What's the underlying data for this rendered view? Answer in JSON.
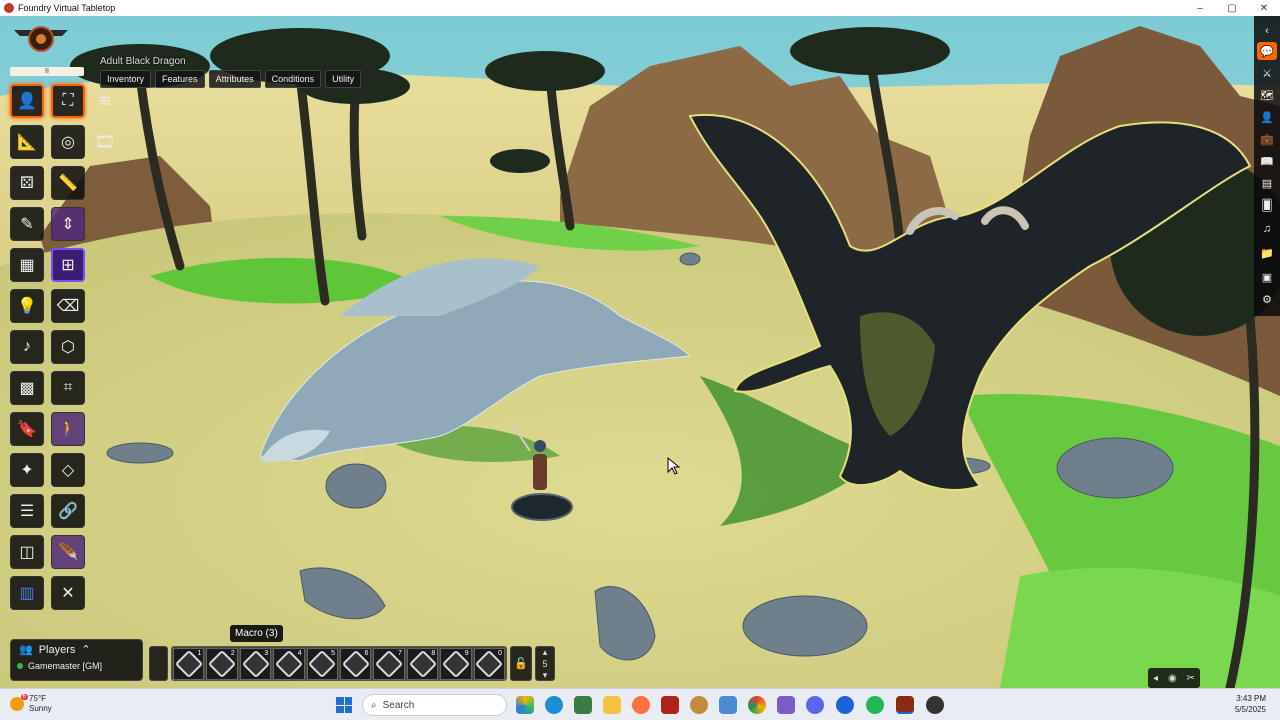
{
  "window": {
    "title": "Foundry Virtual Tabletop",
    "controls": [
      "–",
      "▢",
      "✕"
    ]
  },
  "hud": {
    "token_name": "Adult Black Dragon",
    "pause_marker": "II",
    "tabs": [
      "Inventory",
      "Features",
      "Attributes",
      "Conditions",
      "Utility"
    ]
  },
  "toolbar": {
    "tools": [
      {
        "name": "token-controls",
        "glyph": "👤",
        "state": "active"
      },
      {
        "name": "select-targets",
        "glyph": "⛶",
        "state": "active"
      },
      {
        "name": "database",
        "glyph": "≋",
        "state": "normal"
      },
      {
        "name": "measure-ruler",
        "glyph": "📐",
        "state": "normal"
      },
      {
        "name": "target",
        "glyph": "◎",
        "state": "normal"
      },
      {
        "name": "film",
        "glyph": "🎞",
        "state": "normal"
      },
      {
        "name": "dice-group",
        "glyph": "⚄",
        "state": "normal"
      },
      {
        "name": "ruler",
        "glyph": "📏",
        "state": "normal"
      },
      {
        "name": "pencil",
        "glyph": "✎",
        "state": "normal"
      },
      {
        "name": "elevation",
        "glyph": "⇕",
        "state": "purple"
      },
      {
        "name": "walls",
        "glyph": "▦",
        "state": "normal"
      },
      {
        "name": "grid",
        "glyph": "⊞",
        "state": "purple-active"
      },
      {
        "name": "lighting",
        "glyph": "💡",
        "state": "normal"
      },
      {
        "name": "eraser",
        "glyph": "⌫",
        "state": "normal"
      },
      {
        "name": "sounds",
        "glyph": "♪",
        "state": "normal"
      },
      {
        "name": "cube",
        "glyph": "⬡",
        "state": "normal"
      },
      {
        "name": "tiles",
        "glyph": "▩",
        "state": "normal"
      },
      {
        "name": "scan",
        "glyph": "⌗",
        "state": "normal"
      },
      {
        "name": "notes",
        "glyph": "🔖",
        "state": "normal"
      },
      {
        "name": "walk",
        "glyph": "🚶",
        "state": "purple"
      },
      {
        "name": "magic-wand",
        "glyph": "✦",
        "state": "normal"
      },
      {
        "name": "regions",
        "glyph": "◇",
        "state": "normal"
      },
      {
        "name": "list",
        "glyph": "☰",
        "state": "normal"
      },
      {
        "name": "link",
        "glyph": "🔗",
        "state": "normal"
      },
      {
        "name": "layers",
        "glyph": "◫",
        "state": "normal"
      },
      {
        "name": "feather",
        "glyph": "🪶",
        "state": "purple"
      },
      {
        "name": "compendium",
        "glyph": "▥",
        "state": "normal"
      },
      {
        "name": "close",
        "glyph": "✕",
        "state": "normal"
      }
    ]
  },
  "players": {
    "header": "Players",
    "gm_label": "Gamemaster [GM]"
  },
  "macro": {
    "tooltip": "Macro (3)",
    "slots": [
      "1",
      "2",
      "3",
      "4",
      "5",
      "6",
      "7",
      "8",
      "9",
      "0"
    ],
    "page": "5",
    "lock_glyph": "🔓"
  },
  "sidebar": {
    "icons": [
      {
        "name": "chat-icon",
        "glyph": "💬",
        "active": true
      },
      {
        "name": "combat-icon",
        "glyph": "⚔",
        "active": false
      },
      {
        "name": "scenes-icon",
        "glyph": "🗺",
        "active": false
      },
      {
        "name": "actors-icon",
        "glyph": "👤",
        "active": false
      },
      {
        "name": "items-icon",
        "glyph": "💼",
        "active": false
      },
      {
        "name": "journal-icon",
        "glyph": "📖",
        "active": false
      },
      {
        "name": "tables-icon",
        "glyph": "▤",
        "active": false
      },
      {
        "name": "cards-icon",
        "glyph": "🂠",
        "active": false
      },
      {
        "name": "playlists-icon",
        "glyph": "♫",
        "active": false
      },
      {
        "name": "compendium-icon",
        "glyph": "📁",
        "active": false
      },
      {
        "name": "notes-icon",
        "glyph": "▣",
        "active": false
      },
      {
        "name": "settings-icon",
        "glyph": "⚙",
        "active": false
      }
    ]
  },
  "taskbar": {
    "weather_temp": "75°F",
    "weather_desc": "Sunny",
    "weather_badge": "6",
    "search_placeholder": "Search",
    "time": "3:43 PM",
    "date": "5/5/2025"
  },
  "colors": {
    "accent": "#ff6400",
    "sky": "#8fd3d8",
    "sand": "#e4dca0",
    "grass": "#6fd04a"
  }
}
